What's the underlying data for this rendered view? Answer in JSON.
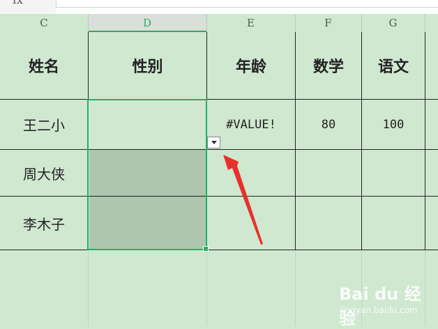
{
  "columns": [
    "C",
    "D",
    "E",
    "F",
    "G"
  ],
  "header_row": [
    "姓名",
    "性别",
    "年龄",
    "数学",
    "语文"
  ],
  "rows": [
    {
      "name": "王二小",
      "gender": "",
      "age": "#VALUE!",
      "math": "80",
      "chinese": "100"
    },
    {
      "name": "周大侠",
      "gender": "",
      "age": "",
      "math": "",
      "chinese": ""
    },
    {
      "name": "李木子",
      "gender": "",
      "age": "",
      "math": "",
      "chinese": ""
    }
  ],
  "formula_bar": {
    "icon": "fx"
  },
  "watermark": {
    "brand": "Bai du 经验",
    "url": "jingyan.baidu.com"
  },
  "colors": {
    "sheet_bg": "#cfe8cf",
    "selection": "#22b163",
    "selected_fill": "#aec6ae",
    "arrow": "#e8302c"
  }
}
